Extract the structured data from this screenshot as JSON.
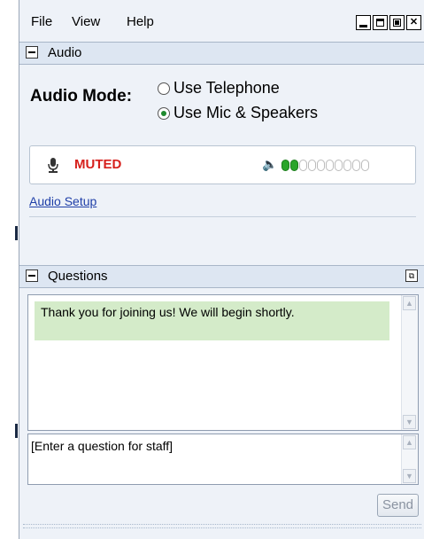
{
  "menu": {
    "file": "File",
    "view": "View",
    "help": "Help"
  },
  "audio": {
    "section_title": "Audio",
    "mode_label": "Audio Mode:",
    "options": [
      "Use Telephone",
      "Use Mic & Speakers"
    ],
    "selected_option": "Use Mic & Speakers",
    "mic_status": "MUTED",
    "volume_level_fraction": 0.2,
    "setup_link": "Audio Setup"
  },
  "questions": {
    "section_title": "Questions",
    "message": "Thank you for joining us!  We will begin shortly.",
    "input_placeholder": "[Enter a question for staff]",
    "send_label": "Send"
  },
  "colors": {
    "muted_text": "#d6201c",
    "message_bg": "#d4ebc9",
    "link": "#1f3fa8",
    "meter_on": "#2aa52a"
  }
}
